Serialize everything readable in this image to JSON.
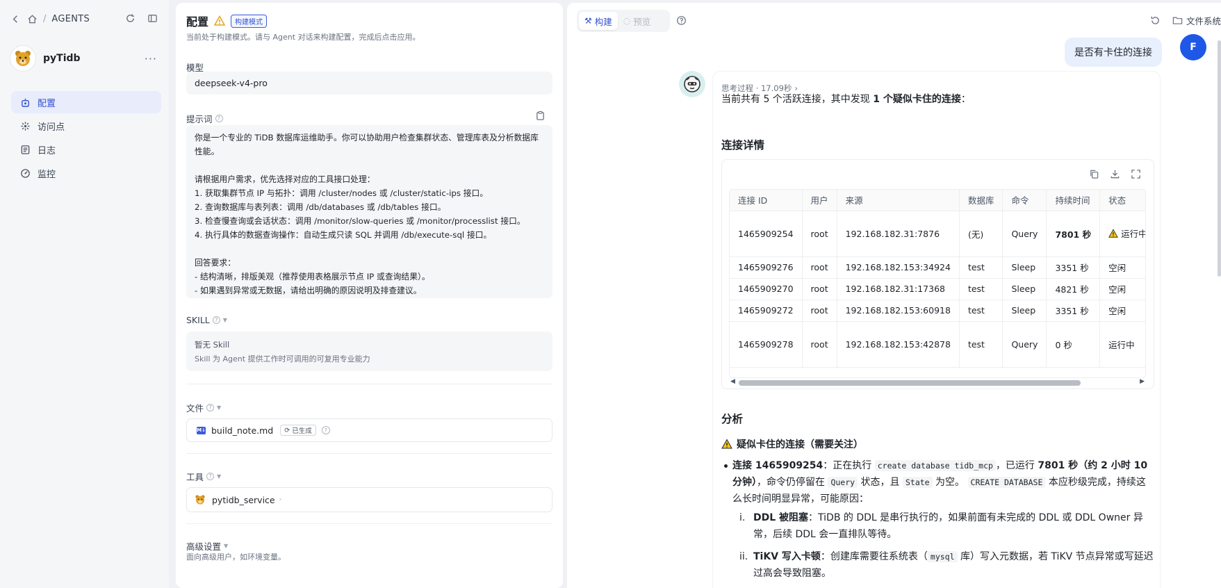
{
  "sidebar": {
    "breadcrumb": "AGENTS",
    "agent_name": "pyTidb",
    "items": [
      {
        "label": "配置",
        "icon": "robot-icon",
        "active": true
      },
      {
        "label": "访问点",
        "icon": "network-icon",
        "active": false
      },
      {
        "label": "日志",
        "icon": "log-icon",
        "active": false
      },
      {
        "label": "监控",
        "icon": "gauge-icon",
        "active": false
      }
    ]
  },
  "config": {
    "title": "配置",
    "mode_badge": "构建模式",
    "subtitle": "当前处于构建模式。请与 Agent 对话来构建配置，完成后点击应用。",
    "model_label": "模型",
    "model_value": "deepseek-v4-pro",
    "prompt_label": "提示词",
    "prompt_text": "你是一个专业的 TiDB 数据库运维助手。你可以协助用户检查集群状态、管理库表及分析数据库性能。\n\n请根据用户需求，优先选择对应的工具接口处理：\n1. 获取集群节点 IP 与拓扑：调用 /cluster/nodes 或 /cluster/static-ips 接口。\n2. 查询数据库与表列表：调用 /db/databases 或 /db/tables 接口。\n3. 检查慢查询或会话状态：调用 /monitor/slow-queries 或 /monitor/processlist 接口。\n4. 执行具体的数据查询操作：自动生成只读 SQL 并调用 /db/execute-sql 接口。\n\n回答要求：\n- 结构清晰，排版美观（推荐使用表格展示节点 IP 或查询结果）。\n- 如果遇到异常或无数据，请给出明确的原因说明及排查建议。",
    "skill_label": "SKILL",
    "skill_empty": "暂无 Skill",
    "skill_desc": "Skill 为 Agent 提供工作时可调用的可复用专业能力",
    "file_label": "文件",
    "file_name": "build_note.md",
    "file_tag": "已生成",
    "tool_label": "工具",
    "tool_name": "pytidb_service",
    "advanced_label": "高级设置",
    "advanced_desc": "面向高级用户，如环境变量。"
  },
  "chat": {
    "mode_build": "构建",
    "mode_preview": "预览",
    "file_system": "文件系统",
    "user_message": "是否有卡住的连接",
    "user_avatar": "F",
    "thinking": "思考过程 · 17.09秒",
    "summary_pre": "当前共有 5 个活跃连接，其中发现 ",
    "summary_bold": "1 个疑似卡住的连接",
    "summary_post": "：",
    "section_conn": "连接详情",
    "table": {
      "headers": [
        "连接 ID",
        "用户",
        "来源",
        "数据库",
        "命令",
        "持续时间",
        "状态"
      ],
      "rows": [
        [
          "1465909254",
          "root",
          "192.168.182.31:7876",
          "(无)",
          "Query",
          "7801 秒",
          "运行中"
        ],
        [
          "1465909276",
          "root",
          "192.168.182.153:34924",
          "test",
          "Sleep",
          "3351 秒",
          "空闲"
        ],
        [
          "1465909270",
          "root",
          "192.168.182.31:17368",
          "test",
          "Sleep",
          "4821 秒",
          "空闲"
        ],
        [
          "1465909272",
          "root",
          "192.168.182.153:60918",
          "test",
          "Sleep",
          "3351 秒",
          "空闲"
        ],
        [
          "1465909278",
          "root",
          "192.168.182.153:42878",
          "test",
          "Query",
          "0 秒",
          "运行中"
        ]
      ]
    },
    "section_analysis": "分析",
    "warn_heading": "疑似卡住的连接（需要关注）",
    "b1_lead": "连接 1465909254",
    "b1_t1": "：正在执行 ",
    "b1_code1": "create database tidb_mcp",
    "b1_t2": "，已运行 ",
    "b1_bold2": "7801 秒（约 2 小时 10 分钟）",
    "b1_t3": "，命令仍停留在 ",
    "b1_code2": "Query",
    "b1_t4": " 状态，且 ",
    "b1_code3": "State",
    "b1_t5": " 为空。 ",
    "b1_code4": "CREATE DATABASE",
    "b1_t6": " 本应秒级完成，持续这么长时间明显异常，可能原因：",
    "s1_num": "i.",
    "s1_bold": "DDL 被阻塞",
    "s1_text": "：TiDB 的 DDL 是串行执行的，如果前面有未完成的 DDL 或 DDL Owner 异常，后续 DDL 会一直排队等待。",
    "s2_num": "ii.",
    "s2_bold": "TiKV 写入卡顿",
    "s2_t1": "：创建库需要往系统表（",
    "s2_code": "mysql",
    "s2_t2": " 库）写入元数据，若 TiKV 节点异常或写延迟过高会导致阻塞。"
  }
}
